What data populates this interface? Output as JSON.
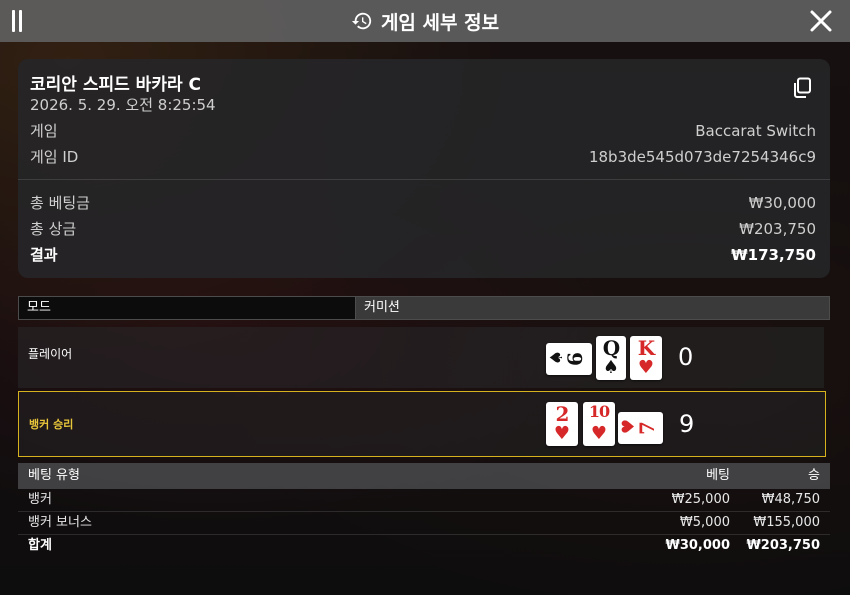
{
  "header": {
    "title": "게임 세부 정보"
  },
  "info": {
    "table_name": "코리안 스피드 바카라 C",
    "datetime": "2026. 5. 29. 오전 8:25:54",
    "game_label": "게임",
    "game_value": "Baccarat Switch",
    "game_id_label": "게임 ID",
    "game_id_value": "18b3de545d073de7254346c9",
    "total_bet_label": "총 베팅금",
    "total_bet_value": "₩30,000",
    "total_win_label": "총 상금",
    "total_win_value": "₩203,750",
    "result_label": "결과",
    "result_value": "₩173,750"
  },
  "mode": {
    "label": "모드",
    "value": "커미션"
  },
  "hands": {
    "player": {
      "label": "플레이어",
      "score": "0",
      "cards": [
        {
          "rank": "6",
          "suit": "♠",
          "sideways": true
        },
        {
          "rank": "Q",
          "suit": "♠"
        },
        {
          "rank": "K",
          "suit": "♥"
        }
      ]
    },
    "banker": {
      "label": "뱅커 승리",
      "score": "9",
      "cards": [
        {
          "rank": "2",
          "suit": "♥"
        },
        {
          "rank": "10",
          "suit": "♥"
        },
        {
          "rank": "7",
          "suit": "♥",
          "sideways": true
        }
      ]
    }
  },
  "bets": {
    "headers": {
      "type": "베팅 유형",
      "bet": "베팅",
      "win": "승"
    },
    "rows": [
      {
        "type": "뱅커",
        "bet": "₩25,000",
        "win": "₩48,750"
      },
      {
        "type": "뱅커 보너스",
        "bet": "₩5,000",
        "win": "₩155,000"
      },
      {
        "type": "합계",
        "bet": "₩30,000",
        "win": "₩203,750"
      }
    ]
  },
  "colors": {
    "accent": "#d5b21e",
    "red_suit": "#d62828",
    "black_suit": "#111111"
  }
}
